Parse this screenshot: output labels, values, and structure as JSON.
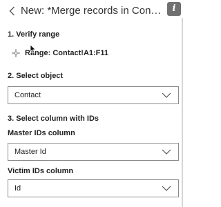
{
  "header": {
    "title": "New: *Merge records in Contact",
    "back_icon": "chevron-left-icon",
    "info_label": "i"
  },
  "step1": {
    "title": "1. Verify range",
    "range_text": "Range: Contact!A1:F11"
  },
  "step2": {
    "title": "2. Select object",
    "object_value": "Contact"
  },
  "step3": {
    "title": "3. Select column with IDs",
    "master_label": "Master IDs column",
    "master_value": "Master Id",
    "victim_label": "Victim IDs column",
    "victim_value": "Id"
  },
  "colors": {
    "info_bg": "#707070",
    "border": "#8a8a8a",
    "text": "#222222"
  }
}
